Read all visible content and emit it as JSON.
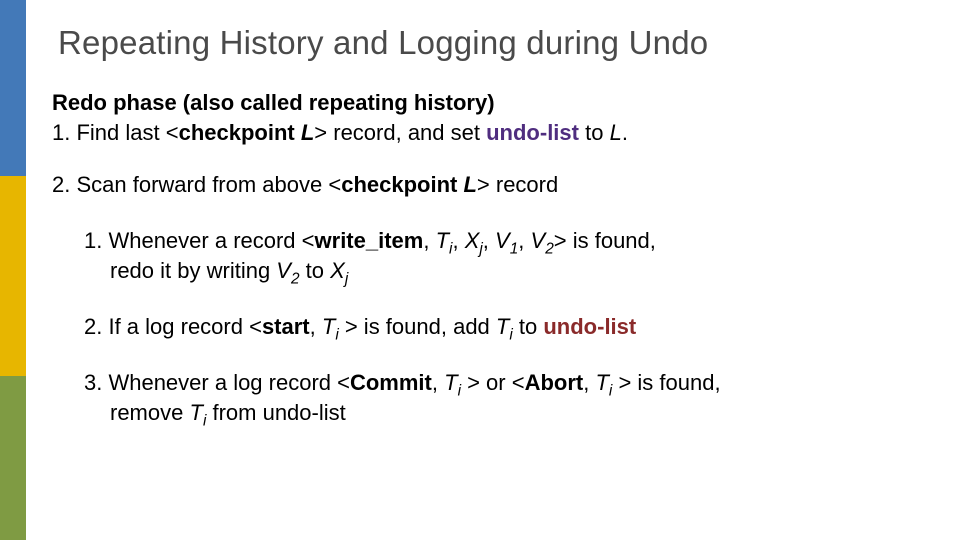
{
  "slide": {
    "title": "Repeating History and Logging during Undo",
    "heading": "Redo phase (also called repeating history)",
    "step1_a": "1. Find last <",
    "step1_b": "checkpoint ",
    "step1_L": "L",
    "step1_c": "> record, and set ",
    "step1_undo": "undo-list",
    "step1_d": " to ",
    "step1_L2": "L",
    "step1_e": ".",
    "step2_a": "2. Scan forward from above <",
    "step2_b": "checkpoint ",
    "step2_L": "L",
    "step2_c": "> record",
    "sub1_a": "1. Whenever a  record <",
    "sub1_b": "write_item",
    "sub1_c": ", ",
    "sub1_T": "T",
    "sub1_i": "i",
    "sub1_d": ", ",
    "sub1_X": "X",
    "sub1_j": "j",
    "sub1_e": ",  ",
    "sub1_V1": "V",
    "sub1_1": "1",
    "sub1_f": ",  ",
    "sub1_V2": "V",
    "sub1_2": "2",
    "sub1_g": "> is found,",
    "sub1b_a": "redo it by writing ",
    "sub1b_V": "V",
    "sub1b_2": "2",
    "sub1b_b": " to ",
    "sub1b_X": "X",
    "sub1b_j": "j",
    "sub2_a": "2.  If a log record <",
    "sub2_b": "start",
    "sub2_c": ", ",
    "sub2_T": "T",
    "sub2_i": "i",
    "sub2_d": " > is found, add ",
    "sub2_T2": "T",
    "sub2_i2": "i",
    "sub2_e": " to ",
    "sub2_undo": "undo-list",
    "sub3_a": "3. Whenever a log record <",
    "sub3_b": "Commit",
    "sub3_c": ", ",
    "sub3_T": "T",
    "sub3_i": "i",
    "sub3_d": " > or <",
    "sub3_e": "Abort",
    "sub3_f": ", ",
    "sub3_T2": "T",
    "sub3_i2": "i",
    "sub3_g": " > is found,",
    "sub3b_a": "remove ",
    "sub3b_T": "T",
    "sub3b_i": "i",
    "sub3b_b": "  from undo-list"
  }
}
